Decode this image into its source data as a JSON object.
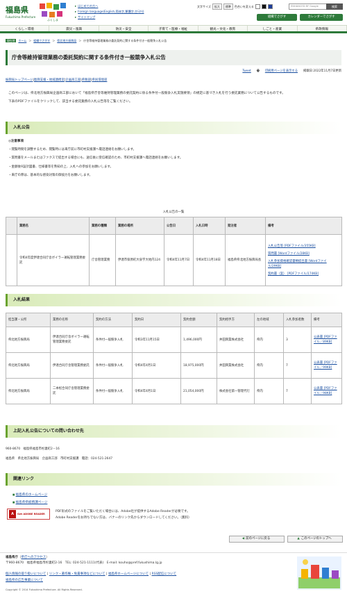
{
  "header": {
    "logo": "福島県",
    "logo_sub": "Fukushima Prefecture",
    "top_links": [
      "はじめての方へ",
      "Foreign language(English,简体字,繁體字,한국어)",
      "サイトマップ"
    ],
    "font_size_label": "文字サイズ",
    "enlarge": "拡大",
    "standard": "標準",
    "color_label": "色合いを変える",
    "search_placeholder": "ENHANCED BY Google",
    "search_button": "検索",
    "org_button": "組織でさがす",
    "calendar_button": "カレンダーでさがす"
  },
  "gnav": [
    "くらし・環境",
    "震災・復興",
    "防災・安全",
    "子育て・医療・福祉",
    "観光・文化・教育",
    "しごと・産業",
    "県政情報"
  ],
  "breadcrumb": {
    "tag": "現在地",
    "items": [
      "ホーム",
      "組織でさがす",
      "県北地方振興局",
      "庁舎等維持管理業務の委託契約に関する条件付き一般競争入札公告"
    ]
  },
  "page": {
    "title": "庁舎等維持管理業務の委託契約に関する条件付き一般競争入札公告",
    "tweet": "Tweet",
    "print": "印刷用ページを表示する",
    "date": "掲載日:2022年11月7日更新",
    "dept_links": [
      "振興局トップページ",
      "復興支援・地域連携室",
      "企画商工部",
      "県税部",
      "県民環境部"
    ],
    "intro1": "このページは、県北地方振興局企画商工部において「福島県庁舎等維持管理業務の委託契約に係る条件付一般競争入札実施要領」の規定に基づき入札を行う委託業務について公告するものです。",
    "intro2": "下表のPDFファイルをクリックして、該当する委託業務の入札公告等をご覧ください。"
  },
  "section1": {
    "heading": "入札公告",
    "notes_title": "◎注意事項",
    "notes": [
      "・閲覧時間を調整するため、閲覧時には来庁前に市町村支援課へ電話連絡をお願いします。",
      "・質問書をメールまたはファクスで提出する場合にも、送信後に受信確認のため、市町村支援課へ電話連絡をお願いします。",
      "・金額後9設計図書、仕様書等を熟知の上、入札への参加をお願いします。",
      "・来庁の際は、基本的な感染対策の御協力をお願いします。"
    ],
    "table_caption": "入札公告の一覧",
    "headers": [
      "業務名",
      "業務の種類",
      "業務の場所",
      "公告日",
      "入札日時",
      "発注者",
      "備考"
    ],
    "row": {
      "name": "令和4年度伊達合同庁舎ボイラー運転管理業務委託",
      "kind": "庁舎管理業務",
      "place": "伊達市保原町大泉字大地内124",
      "notice": "令和4年11月7日",
      "bid": "令和4年11月18日",
      "orderer": "福島県県北地方振興局長",
      "docs": [
        "入札公告等 [PDFファイル/355KB]",
        "質問書 [Wordファイル/28KB]",
        "入札参加資格確認書類提出書 [Wordファイル/29KB]",
        "契約書（案） [PDFファイル/174KB]"
      ]
    }
  },
  "section2": {
    "heading": "入札結果",
    "headers": [
      "担当課・公所",
      "業務の名称",
      "契約の方法",
      "契約日",
      "契約金額",
      "契約相手方",
      "左の地域",
      "入札参加者数",
      "備考"
    ],
    "rows": [
      [
        "県北地方振興局",
        "伊達合同庁舎ボイラー運転管理業務委託",
        "条件付一般競争入札",
        "令和3年11月15日",
        "1,496,000円",
        "井田興業株式会社",
        "県内",
        "3",
        "公表書 [PDFファイル／89KB]"
      ],
      [
        "県北地方振興局",
        "伊達合同庁舎管理業務委託",
        "条件付一般競争入札",
        "令和4年4月1日",
        "18,975,000円",
        "井田興業株式会社",
        "県内",
        "7",
        "公表書 [PDFファイル／99KB]"
      ],
      [
        "県北地方振興局",
        "二本松合同庁舎管理業務委託",
        "条件付一般競争入札",
        "令和4年4月1日",
        "21,054,000円",
        "株式会社第一管理代行",
        "県内",
        "7",
        "公表書 [PDFファイル／98KB]"
      ]
    ]
  },
  "section3": {
    "heading": "上記入札公告についての問い合わせ先",
    "address": "960-8670　福島県福島市杉妻町2－16",
    "contact": "福島県　県北地方振興局　企画商工部　市町村支援課　電話：024-521-2647"
  },
  "section4": {
    "heading": "関連リンク",
    "links": [
      "福島県のホームページ",
      "福島県県総務課ページ"
    ],
    "adobe_badge": "Get ADOBE READER",
    "adobe_text1": "PDF形式のファイルをご覧いただく場合には、Adobe社が提供するAdobe Readerが必要です。",
    "adobe_text2": "Adobe Readerをお持ちでない方は、バナーのリンク先からダウンロードしてください。（無料）"
  },
  "pager": {
    "back": "前のページに戻る",
    "top": "このページのトップへ"
  },
  "footer": {
    "name": "福島県庁",
    "access": "県庁へのアクセス",
    "address": "〒960-8670　福島県福島市杉妻町2-16　TEL: 024-521-1111(代表)　E-mail: kouho@pref.fukushima.lg.jp",
    "links": [
      "個人情報の取り扱いについて",
      "リンク・著作権・免責事項などについて",
      "福島県ホームページについて",
      "RSS配信について",
      "福島県の広告事業について"
    ],
    "copyright": "Copyright © 2014 Fukushima Prefecture. All Rights Reserved."
  },
  "colors": {
    "brand_green": "#2d7a3a",
    "link": "#1a4fa0",
    "section_bar": "#d9ebb9"
  }
}
